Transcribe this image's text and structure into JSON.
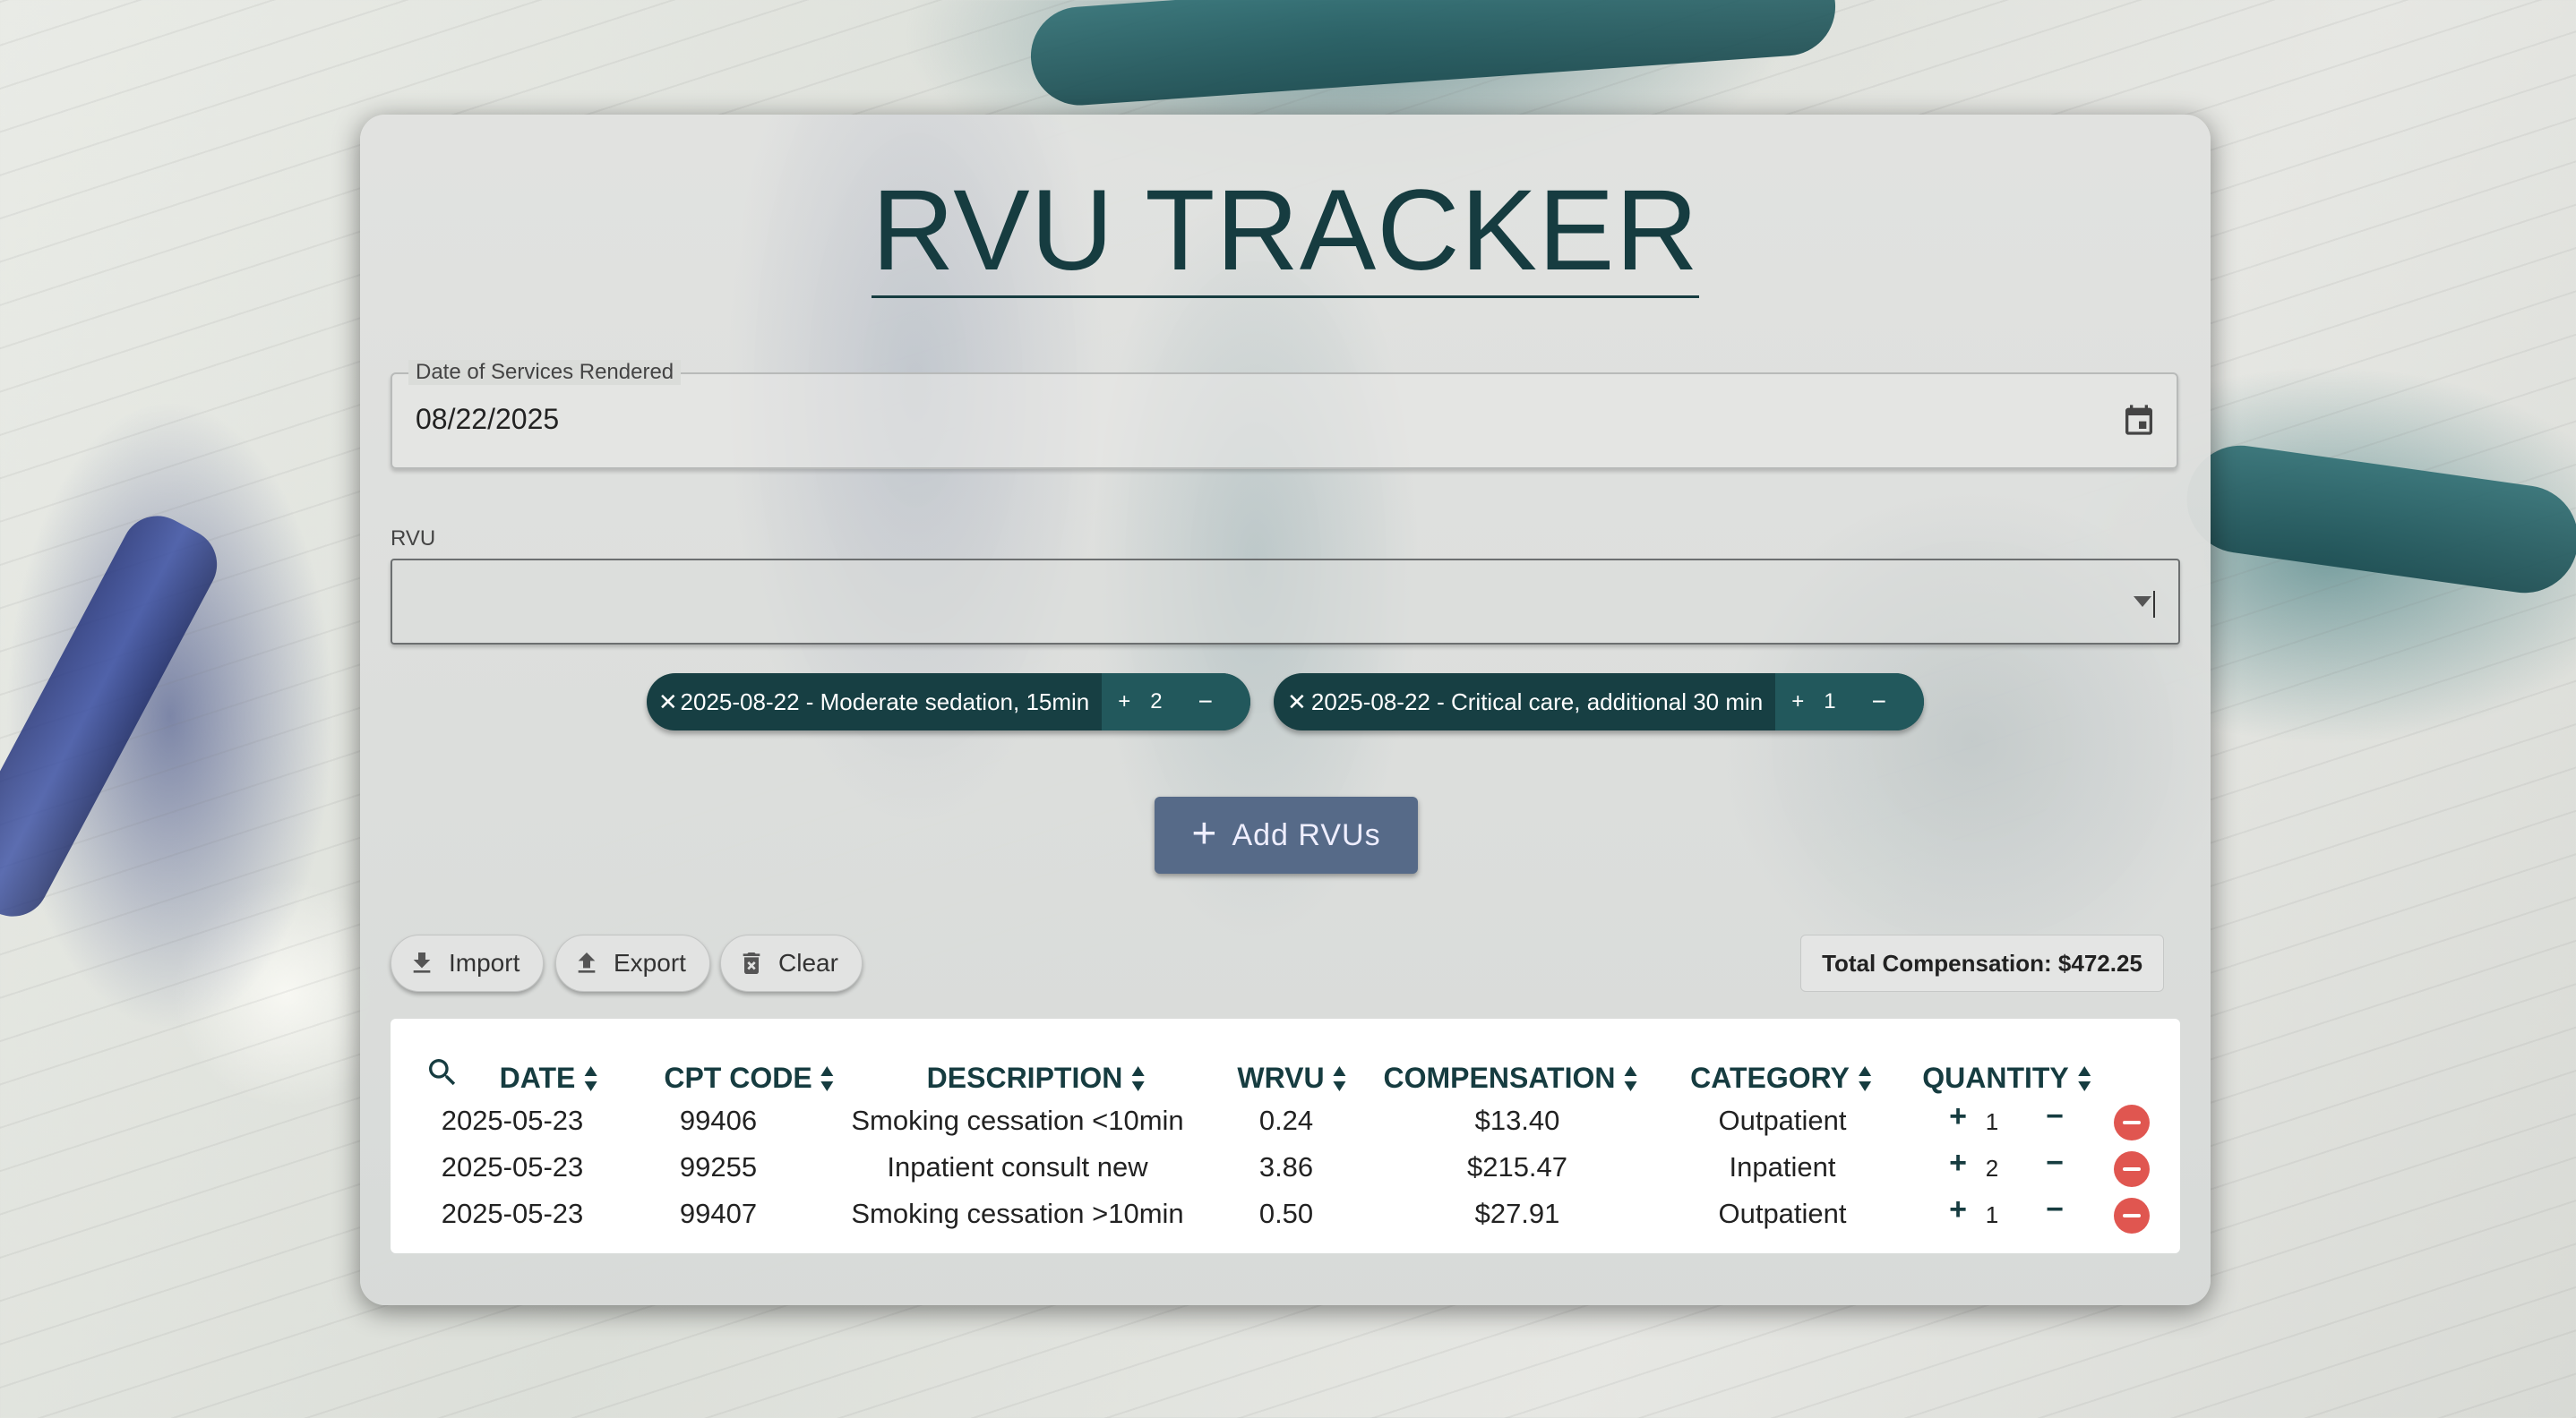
{
  "app": {
    "title": "RVU TRACKER"
  },
  "date_field": {
    "label": "Date of Services Rendered",
    "value": "08/22/2025",
    "icon": "calendar-icon"
  },
  "rvu_field": {
    "label": "RVU",
    "value": ""
  },
  "chips": [
    {
      "label": "2025-08-22 - Moderate sedation, 15min",
      "quantity": "2",
      "plus": "+",
      "minus": "−",
      "remove": "✕"
    },
    {
      "label": "2025-08-22 - Critical care, additional 30 min",
      "quantity": "1",
      "plus": "+",
      "minus": "−",
      "remove": "✕"
    }
  ],
  "add_button": {
    "label": "Add RVUs",
    "icon": "+"
  },
  "toolbar": {
    "import_label": "Import",
    "export_label": "Export",
    "clear_label": "Clear"
  },
  "total": {
    "text": "Total Compensation: $472.25"
  },
  "table": {
    "headers": [
      "DATE",
      "CPT CODE",
      "DESCRIPTION",
      "WRVU",
      "COMPENSATION",
      "CATEGORY",
      "QUANTITY"
    ],
    "rows": [
      {
        "date": "2025-05-23",
        "cpt": "99406",
        "description": "Smoking cessation <10min",
        "wrvu": "0.24",
        "compensation": "$13.40",
        "category": "Outpatient",
        "quantity": "1"
      },
      {
        "date": "2025-05-23",
        "cpt": "99255",
        "description": "Inpatient consult new",
        "wrvu": "3.86",
        "compensation": "$215.47",
        "category": "Inpatient",
        "quantity": "2"
      },
      {
        "date": "2025-05-23",
        "cpt": "99407",
        "description": "Smoking cessation >10min",
        "wrvu": "0.50",
        "compensation": "$27.91",
        "category": "Outpatient",
        "quantity": "1"
      }
    ],
    "plus": "+",
    "minus": "−"
  },
  "colors": {
    "accent": "#163c40",
    "button": "#566a88",
    "delete": "#e05650"
  }
}
